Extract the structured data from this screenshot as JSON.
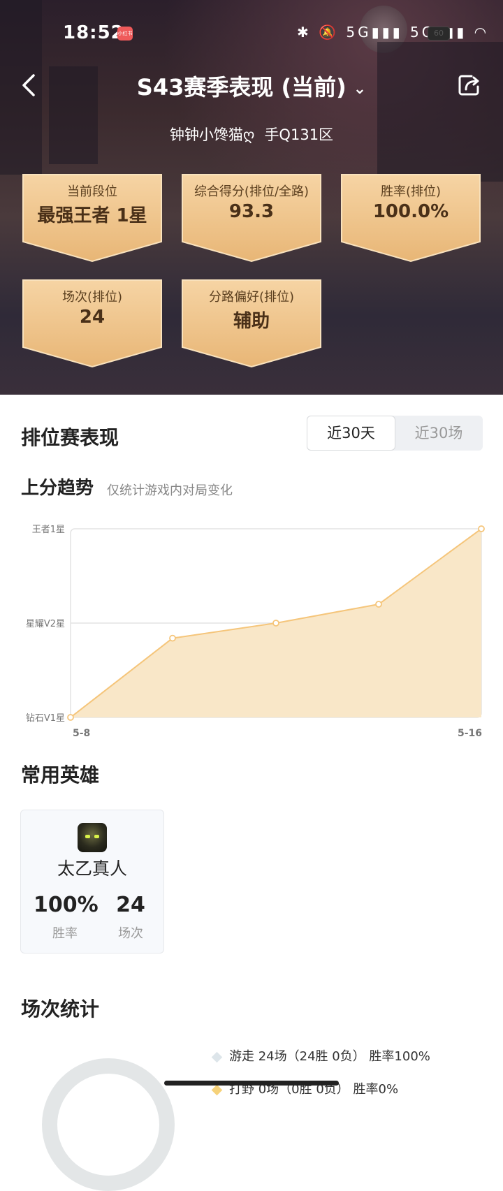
{
  "status_bar": {
    "time": "18:52",
    "notif_app": "小红书",
    "indicators": "✱ 🔕 5G▮▮▮ 5G▮▮▮ ◠",
    "battery": "60"
  },
  "header": {
    "title": "S43赛季表现 (当前)",
    "chevron": "⌄",
    "player": "钟钟小馋猫ღ",
    "server": "手Q131区"
  },
  "stat_cards": [
    {
      "label": "当前段位",
      "value": "最强王者 1星"
    },
    {
      "label": "综合得分(排位/全路)",
      "value": "93.3"
    },
    {
      "label": "胜率(排位)",
      "value": "100.0%"
    },
    {
      "label": "场次(排位)",
      "value": "24"
    },
    {
      "label": "分路偏好(排位)",
      "value": "辅助"
    }
  ],
  "ranked": {
    "title": "排位赛表现",
    "tabs": [
      {
        "label": "近30天",
        "active": true
      },
      {
        "label": "近30场",
        "active": false
      }
    ]
  },
  "trend": {
    "title": "上分趋势",
    "subtitle": "仅统计游戏内对局变化"
  },
  "chart_data": {
    "type": "area",
    "x": [
      "5-8",
      "",
      "",
      "",
      "5-16"
    ],
    "y_ticks": [
      "钻石V1星",
      "星耀V2星",
      "王者1星"
    ],
    "values": [
      0,
      0.84,
      1.0,
      1.2,
      2.0
    ],
    "ylim": [
      0,
      2
    ],
    "x_tick_labels": [
      "5-8",
      "5-16"
    ],
    "color": "#f5c57a",
    "fill": "#f9e7c8",
    "grid": true
  },
  "heroes": {
    "title": "常用英雄",
    "items": [
      {
        "name": "太乙真人",
        "winrate": "100%",
        "winrate_label": "胜率",
        "games": "24",
        "games_label": "场次"
      }
    ]
  },
  "match_stats": {
    "title": "场次统计",
    "legend": [
      {
        "text": "游走 24场（24胜 0负） 胜率100%",
        "color": "#dde5ea"
      },
      {
        "text": "打野 0场（0胜 0负） 胜率0%",
        "color": "#f6d27a"
      }
    ]
  }
}
